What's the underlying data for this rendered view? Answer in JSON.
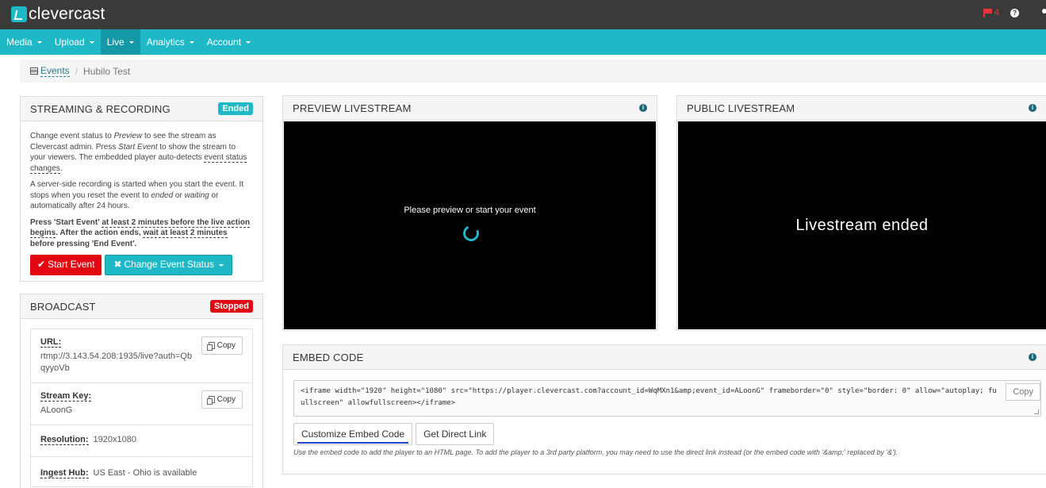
{
  "app": {
    "name": "clevercast",
    "notification_count": "4",
    "help_glyph": "?"
  },
  "nav": [
    {
      "label": "Media",
      "active": false
    },
    {
      "label": "Upload",
      "active": false
    },
    {
      "label": "Live",
      "active": true
    },
    {
      "label": "Analytics",
      "active": false
    },
    {
      "label": "Account",
      "active": false
    }
  ],
  "breadcrumb": {
    "link": "Events",
    "separator": "/",
    "current": "Hubilo Test"
  },
  "streaming": {
    "title": "STREAMING & RECORDING",
    "badge": "Ended",
    "p1_a": "Change event status to ",
    "p1_preview": "Preview",
    "p1_b": " to see the stream as Clevercast admin. Press ",
    "p1_start": "Start Event",
    "p1_c": " to show the stream to your viewers. The embedded player auto-detects ",
    "p1_link": "event status changes",
    "p1_d": ".",
    "p2_a": "A server-side recording is started when you start the event. It stops when you reset the event to ",
    "p2_ended": "ended",
    "p2_b": " or ",
    "p2_waiting": "waiting",
    "p2_c": " or automatically after 24 hours.",
    "p3_a": "Press 'Start Event' ",
    "p3_b": "at least 2 minutes before the live action begins",
    "p3_c": ". After the action ends, ",
    "p3_d": "wait at least 2 minutes",
    "p3_e": " before pressing 'End Event'.",
    "start_btn": "Start Event",
    "start_glyph": "✔",
    "change_btn": "Change Event Status",
    "change_glyph": "✖"
  },
  "broadcast": {
    "title": "BROADCAST",
    "badge": "Stopped",
    "url_label": "URL:",
    "url_value": "rtmp://3.143.54.208:1935/live?auth=QbqyyoVb",
    "key_label": "Stream Key:",
    "key_value": "ALoonG",
    "res_label": "Resolution:",
    "res_value": "1920x1080",
    "hub_label": "Ingest Hub:",
    "hub_value": "US East - Ohio is available",
    "copy_label": "Copy"
  },
  "preview": {
    "title": "PREVIEW LIVESTREAM",
    "message": "Please preview or start your event"
  },
  "public": {
    "title": "PUBLIC LIVESTREAM",
    "message": "Livestream ended"
  },
  "embed": {
    "title": "EMBED CODE",
    "code_line1": "<iframe width=\"1920\" height=\"1080\" src=\"https://player.clevercast.com?account_id=WqMXn1&amp;event_id=ALoonG\" frameborder=\"0\" style=\"border: 0\" allow=\"autoplay; fu",
    "code_line2": "ullscreen\" allowfullscreen></iframe>",
    "copy_label": "Copy",
    "customize_btn": "Customize Embed Code",
    "direct_btn": "Get Direct Link",
    "note": "Use the embed code to add the player to an HTML page. To add the player to a 3rd party platform, you may need to use the direct link instead (or the embed code with '&amp;' replaced by '&')."
  },
  "colors": {
    "accent": "#1eb8c7",
    "topbar": "#3a3a3a",
    "danger": "#e30613"
  }
}
